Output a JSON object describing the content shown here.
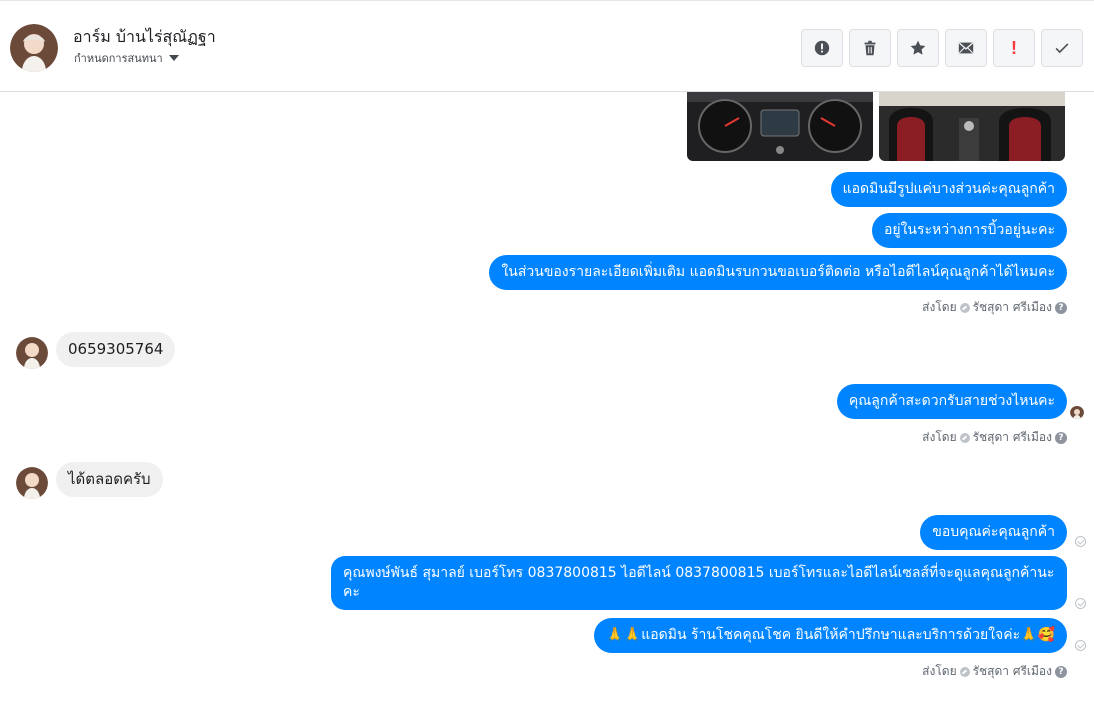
{
  "header": {
    "name": "อาร์ม บ้านไร่สุณัฏฐา",
    "subtitle": "กำหนดการสนทนา",
    "actions": [
      "alert-icon",
      "trash-icon",
      "star-icon",
      "envelope-icon",
      "exclamation-icon",
      "check-icon"
    ],
    "exclamation": "!"
  },
  "photos": [
    "dashboard-photo",
    "seats-photo"
  ],
  "messages": {
    "m1": "แอดมินมีรูปแค่บางส่วนค่ะคุณลูกค้า",
    "m2": "อยู่ในระหว่างการบิ้วอยู่นะคะ",
    "m3": "ในส่วนของรายละเอียดเพิ่มเติม แอดมินรบกวนขอเบอร์ติดต่อ หรือไอดีไลน์คุณลูกค้าได้ไหมคะ",
    "m4": "0659305764",
    "m5": "คุณลูกค้าสะดวกรับสายช่วงไหนคะ",
    "m6": "ได้ตลอดครับ",
    "m7": "ขอบคุณค่ะคุณลูกค้า",
    "m8": "คุณพงษ์พันธ์ สุมาลย์      เบอร์โทร 0837800815  ไอดีไลน์ 0837800815   เบอร์โทรและไอดีไลน์เซลส์ที่จะดูแลคุณลูกค้านะคะ",
    "m9": "🙏🙏แอดมิน ร้านโชคคุณโชค ยินดีให้คำปรึกษาและบริการด้วยใจค่ะ🙏🥰"
  },
  "sent_by": {
    "prefix": "ส่งโดย",
    "name": "รัชสุดา ศรีเมือง",
    "help": "?"
  },
  "colors": {
    "outgoing": "#0084ff",
    "incoming": "#f1f0f0",
    "border": "#dadde1"
  }
}
